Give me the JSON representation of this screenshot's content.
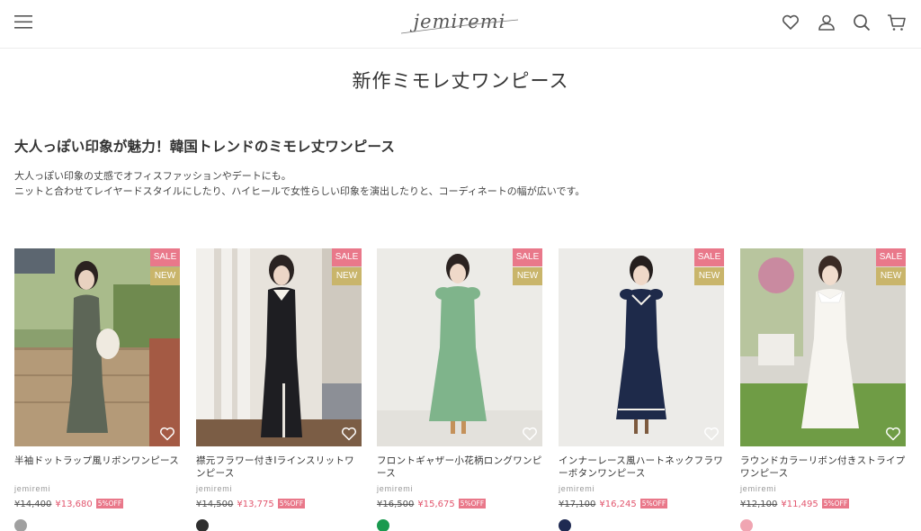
{
  "header": {
    "logo_text": "jemiremi",
    "icons": [
      "menu-icon",
      "heart-icon",
      "account-icon",
      "search-icon",
      "cart-icon"
    ]
  },
  "page_title": "新作ミモレ丈ワンピース",
  "intro": {
    "heading": "大人っぽい印象が魅力！韓国トレンドのミモレ丈ワンピース",
    "line1": "大人っぽい印象の丈感でオフィスファッションやデートにも。",
    "line2": "ニットと合わせてレイヤードスタイルにしたり、ハイヒールで女性らしい印象を演出したりと、コーディネートの幅が広いです。"
  },
  "badges": {
    "sale": "SALE",
    "new": "NEW"
  },
  "products": [
    {
      "name": "半袖ドットラップ風リボンワンピース",
      "vendor": "jemiremi",
      "old_price": "¥14,400",
      "price": "¥13,680",
      "discount": "5%OFF",
      "swatch": "#a0a0a0"
    },
    {
      "name": "襟元フラワー付きIラインスリットワンピース",
      "vendor": "jemiremi",
      "old_price": "¥14,500",
      "price": "¥13,775",
      "discount": "5%OFF",
      "swatch": "#2f2f2f"
    },
    {
      "name": "フロントギャザー小花柄ロングワンピース",
      "vendor": "jemiremi",
      "old_price": "¥16,500",
      "price": "¥15,675",
      "discount": "5%OFF",
      "swatch": "#1a9a4f"
    },
    {
      "name": "インナーレース風ハートネックフラワーボタンワンピース",
      "vendor": "jemiremi",
      "old_price": "¥17,100",
      "price": "¥16,245",
      "discount": "5%OFF",
      "swatch": "#1f2a52"
    },
    {
      "name": "ラウンドカラーリボン付きストライプワンピース",
      "vendor": "jemiremi",
      "old_price": "¥12,100",
      "price": "¥11,495",
      "discount": "5%OFF",
      "swatch": "#f0a5b2"
    }
  ],
  "colors": {
    "sale_badge": "#e9788a",
    "new_badge": "#c9b56b",
    "sale_price": "#e2566e"
  }
}
